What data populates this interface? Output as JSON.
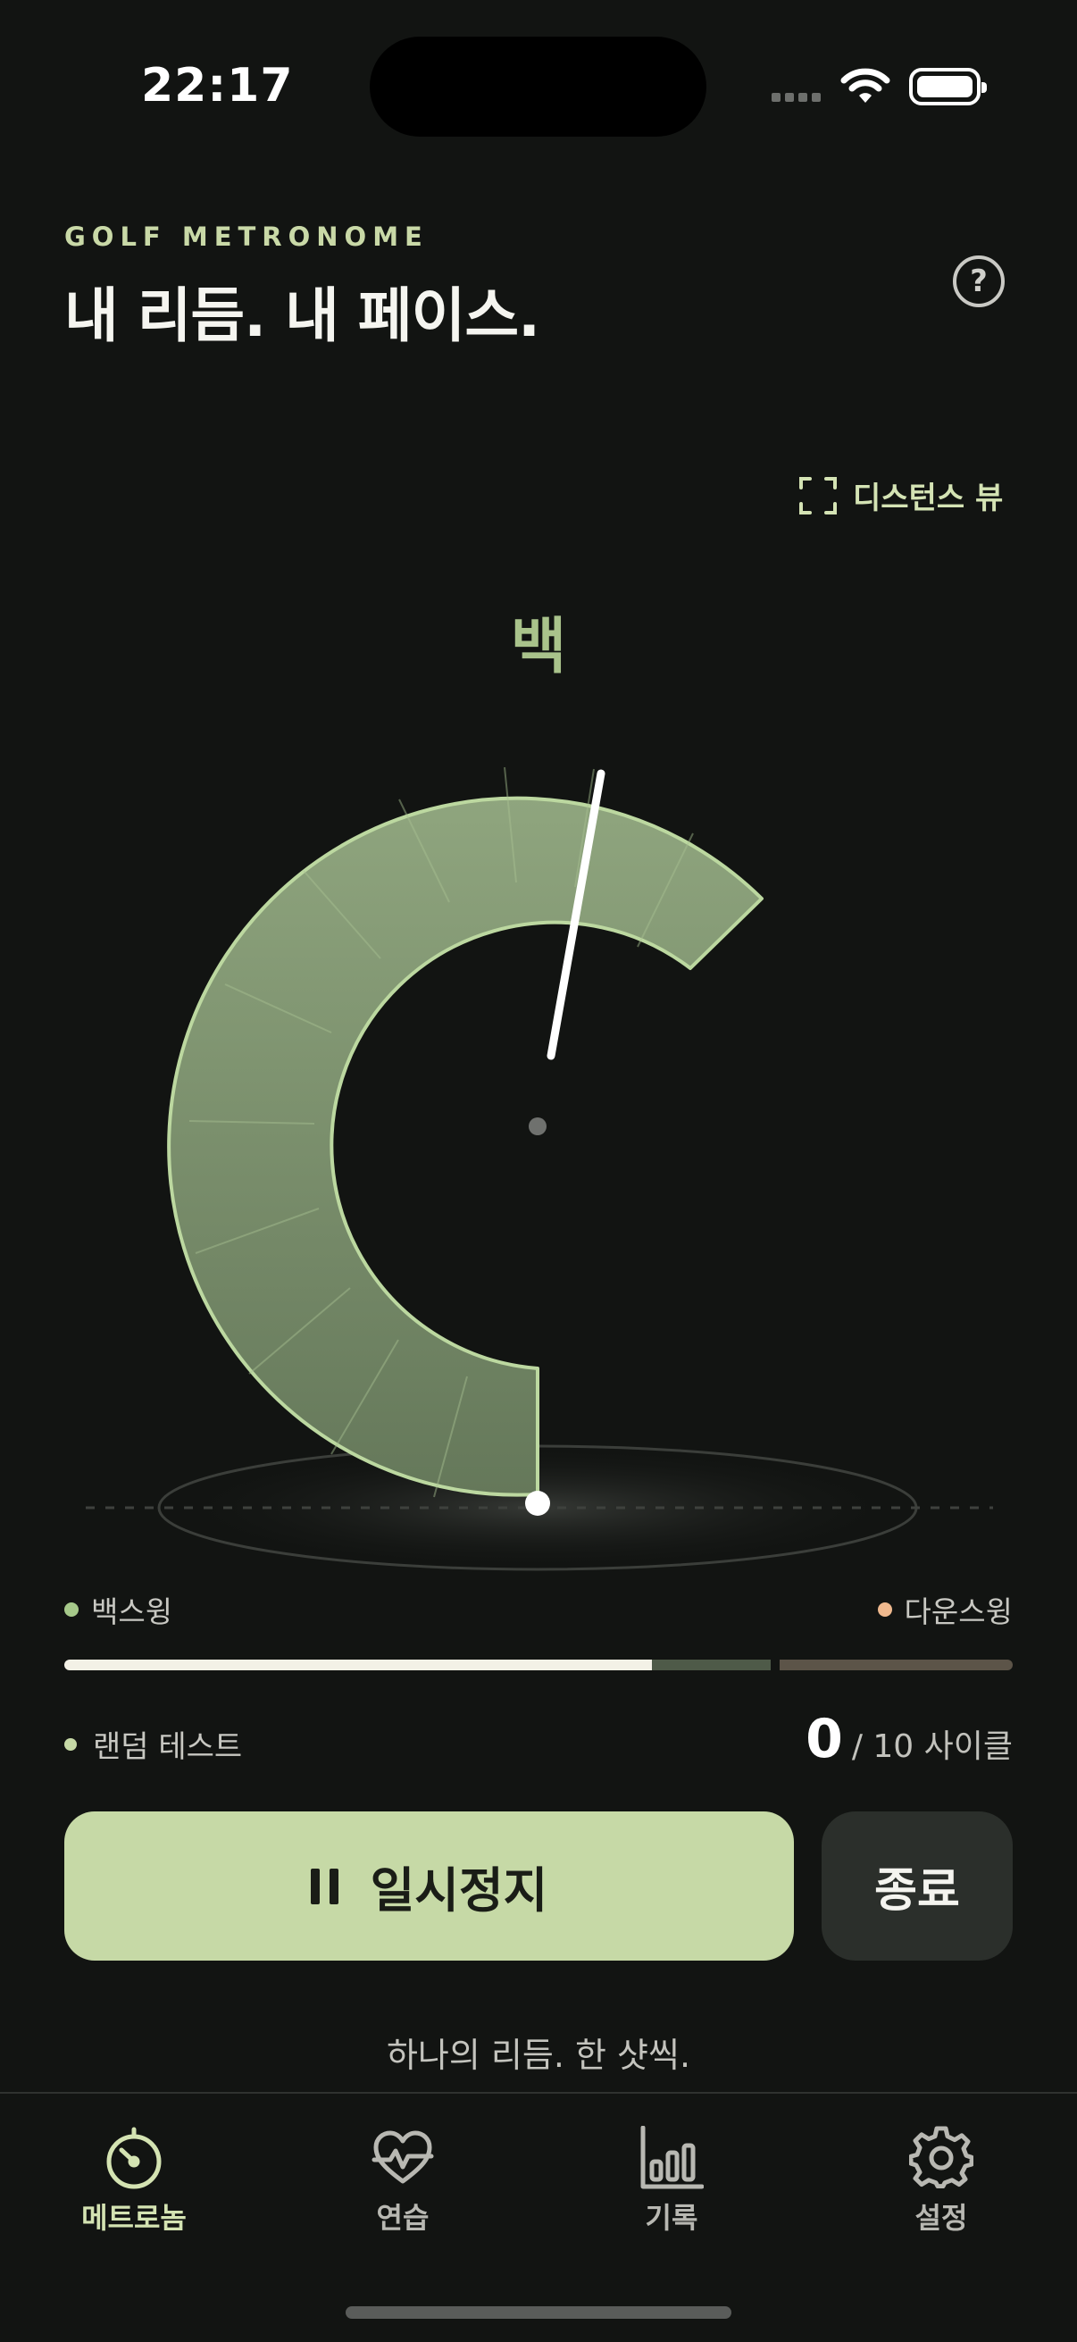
{
  "status_bar": {
    "time": "22:17"
  },
  "header": {
    "eyebrow": "GOLF METRONOME",
    "title": "내 리듬. 내 페이스.",
    "help_icon": "question-circle-icon",
    "help_glyph": "?"
  },
  "distance_view": {
    "label": "디스턴스 뷰",
    "icon": "focus-frame-icon"
  },
  "phase": {
    "current": "백"
  },
  "legend": {
    "backswing": {
      "label": "백스윙",
      "color": "#a6c98a"
    },
    "downswing": {
      "label": "다운스윙",
      "color": "#efb98e"
    }
  },
  "progress": {
    "backswing_fraction": 0.62,
    "colors": {
      "filled": "#f3f1e6",
      "back_remaining": "#4e5a48",
      "down": "#5c5448"
    }
  },
  "random_test": {
    "label": "랜덤 테스트"
  },
  "cycles": {
    "current": "0",
    "total": "/ 10 사이클"
  },
  "controls": {
    "pause_label": "일시정지",
    "end_label": "종료"
  },
  "tagline": "하나의 리듬. 한 샷씩.",
  "tabs": [
    {
      "label": "메트로놈",
      "icon": "metronome-gauge-icon",
      "active": true
    },
    {
      "label": "연습",
      "icon": "heart-pulse-icon",
      "active": false
    },
    {
      "label": "기록",
      "icon": "bar-chart-icon",
      "active": false
    },
    {
      "label": "설정",
      "icon": "gear-icon",
      "active": false
    }
  ],
  "colors": {
    "accent": "#c6d9a6",
    "background": "#121412",
    "arc_fill": "#7f9670",
    "arc_stroke": "#bcd8a0"
  }
}
